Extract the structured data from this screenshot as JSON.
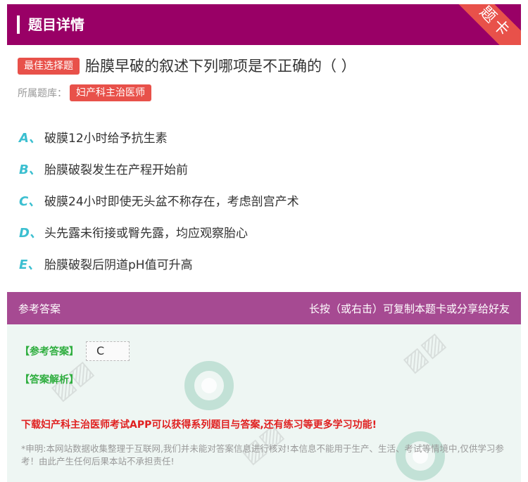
{
  "header": {
    "title": "题目详情",
    "corner_label": "题卡"
  },
  "question": {
    "type_badge": "最佳选择题",
    "text": "胎膜早破的叙述下列哪项是不正确的（  ）",
    "bank_label": "所属题库：",
    "bank_name": "妇产科主治医师"
  },
  "options": [
    {
      "letter": "A、",
      "text": "破膜12小时给予抗生素"
    },
    {
      "letter": "B、",
      "text": "胎膜破裂发生在产程开始前"
    },
    {
      "letter": "C、",
      "text": "破膜24小时即使无头盆不称存在，考虑剖宫产术"
    },
    {
      "letter": "D、",
      "text": "头先露未衔接或臀先露，均应观察胎心"
    },
    {
      "letter": "E、",
      "text": "胎膜破裂后阴道pH值可升高"
    }
  ],
  "answer_section": {
    "title": "参考答案",
    "hint": "长按（或右击）可复制本题卡或分享给好友",
    "answer_label": "【参考答案】",
    "answer_value": "C",
    "analysis_label": "【答案解析】",
    "promo": "下载妇产科主治医师考试APP可以获得系列题目与答案,还有练习等更多学习功能!",
    "disclaimer": "*申明:本网站数据收集整理于互联网,我们并未能对答案信息进行核对!本信息不能用于生产、生活、考试等情境中,仅供学习参考！由此产生任何后果本站不承担责任!"
  },
  "colors": {
    "header_bg": "#990066",
    "badge": "#e8514a",
    "option_letter": "#3bbfd0",
    "answer_head_bg": "#a64a92",
    "answer_body_bg": "#eef6f3",
    "answer_label": "#2fae3f",
    "promo": "#e02020"
  }
}
